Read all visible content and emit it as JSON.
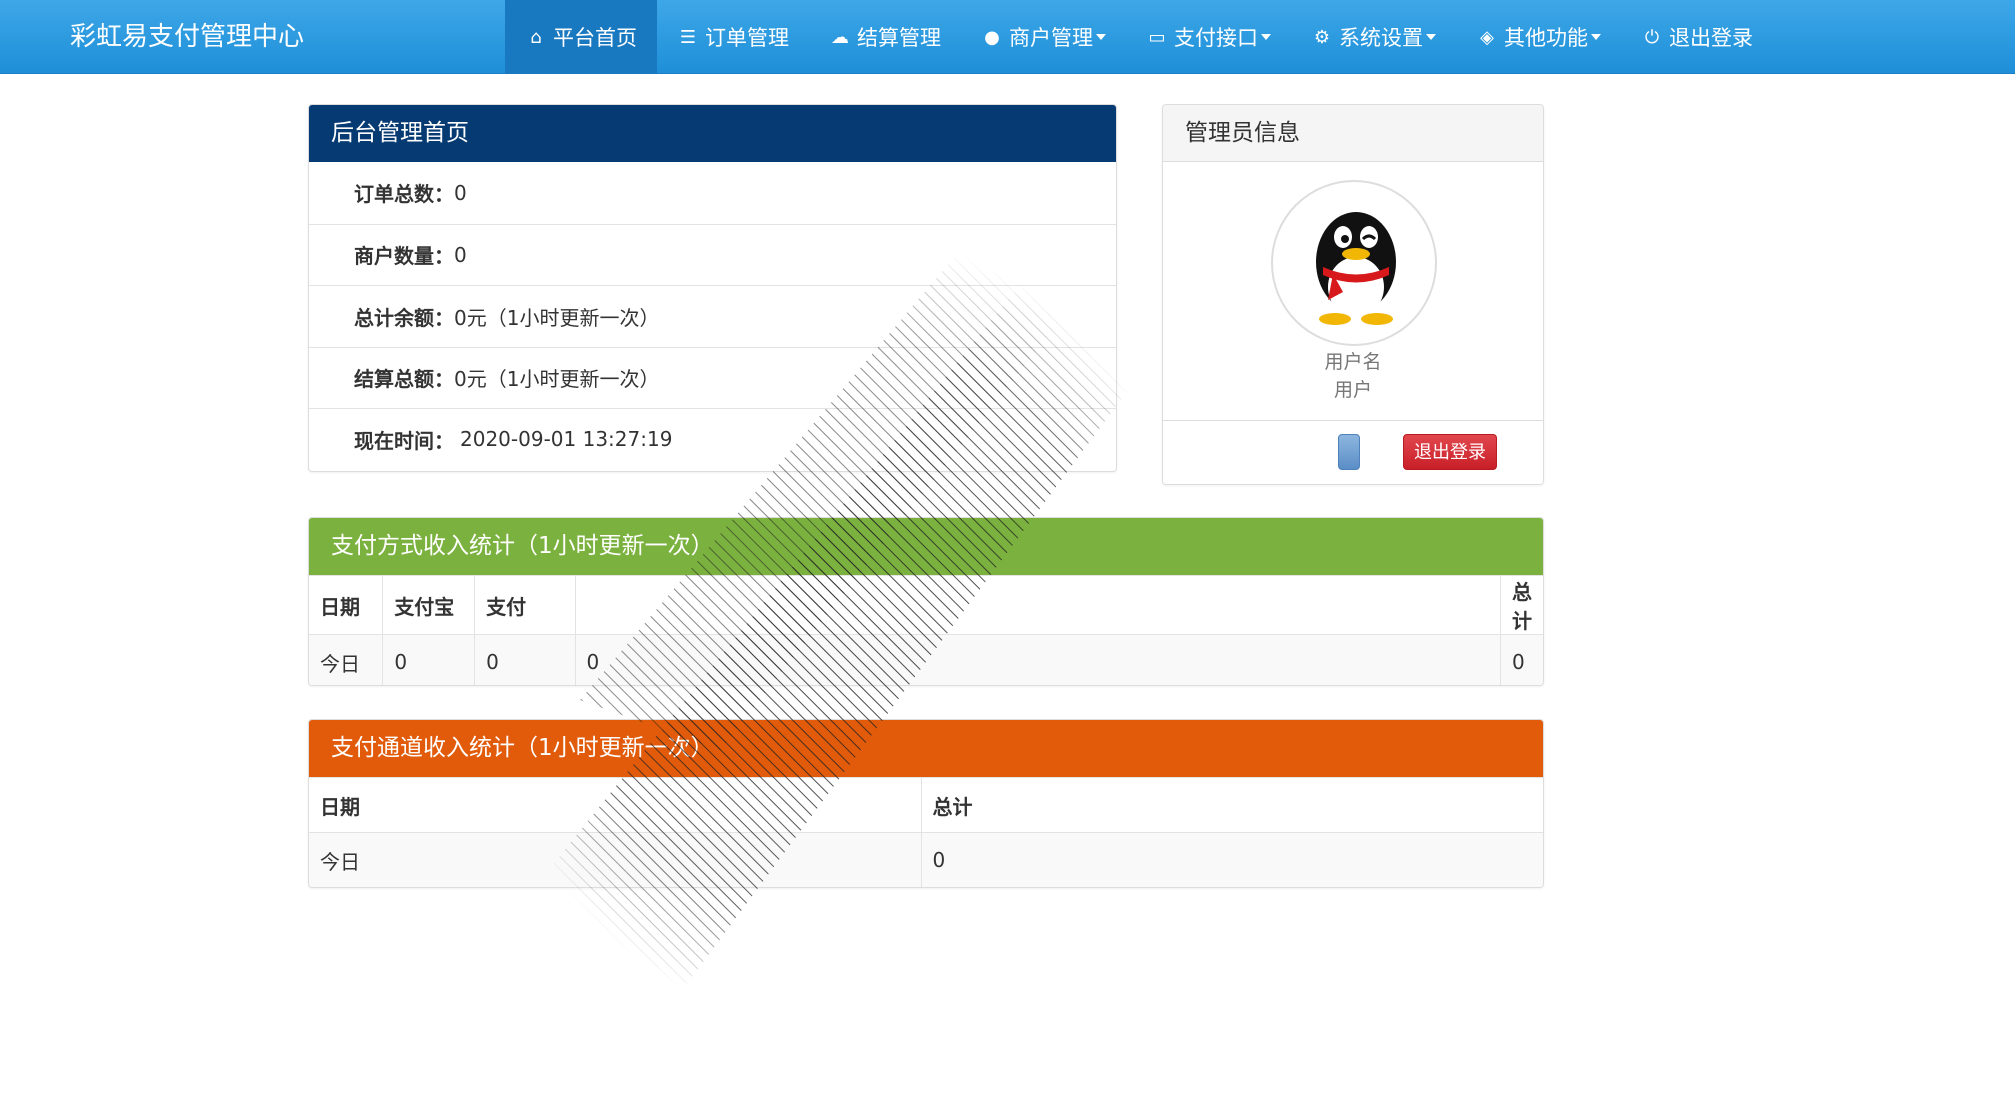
{
  "brand": "彩虹易支付管理中心",
  "nav": [
    {
      "label": "平台首页",
      "icon": "home-icon",
      "glyph": "⌂",
      "dropdown": false,
      "active": true
    },
    {
      "label": "订单管理",
      "icon": "list-icon",
      "glyph": "☰",
      "dropdown": false,
      "active": false
    },
    {
      "label": "结算管理",
      "icon": "cloud-icon",
      "glyph": "☁",
      "dropdown": false,
      "active": false
    },
    {
      "label": "商户管理",
      "icon": "user-icon",
      "glyph": "●",
      "dropdown": true,
      "active": false
    },
    {
      "label": "支付接口",
      "icon": "credit-card-icon",
      "glyph": "▭",
      "dropdown": true,
      "active": false
    },
    {
      "label": "系统设置",
      "icon": "gear-icon",
      "glyph": "⚙",
      "dropdown": true,
      "active": false
    },
    {
      "label": "其他功能",
      "icon": "cube-icon",
      "glyph": "◈",
      "dropdown": true,
      "active": false
    },
    {
      "label": "退出登录",
      "icon": "power-icon",
      "glyph": "⏻",
      "dropdown": false,
      "active": false
    }
  ],
  "overview": {
    "title": "后台管理首页",
    "rows": [
      {
        "label": "订单总数：",
        "value": "0"
      },
      {
        "label": "商户数量：",
        "value": "0"
      },
      {
        "label": "总计余额：",
        "value": "0元（1小时更新一次）"
      },
      {
        "label": "结算总额：",
        "value": "0元（1小时更新一次）"
      },
      {
        "label": "现在时间：",
        "value": "2020-09-01 13:27:19"
      }
    ]
  },
  "admin": {
    "title": "管理员信息",
    "line1": "用户名",
    "line2": "用户",
    "btn_hint": "",
    "btn_blue": "",
    "btn_logout": "退出登录",
    "colors": {
      "heading_bg": "#f5f5f5",
      "logout": "#d9272e"
    }
  },
  "pay_method": {
    "title": "支付方式收入统计（1小时更新一次）",
    "headers": [
      "日期",
      "支付宝",
      "支付",
      "",
      "总计"
    ],
    "rows": [
      [
        "今日",
        "0",
        "0",
        "0",
        "0"
      ]
    ]
  },
  "pay_channel": {
    "title": "支付通道收入统计（1小时更新一次）",
    "headers": [
      "日期",
      "总计"
    ],
    "rows": [
      [
        "今日",
        "0"
      ]
    ]
  },
  "colors": {
    "navbar": "#2196dc",
    "overview_heading": "#063a73",
    "method_heading": "#7bb23f",
    "channel_heading": "#e15b0b"
  }
}
